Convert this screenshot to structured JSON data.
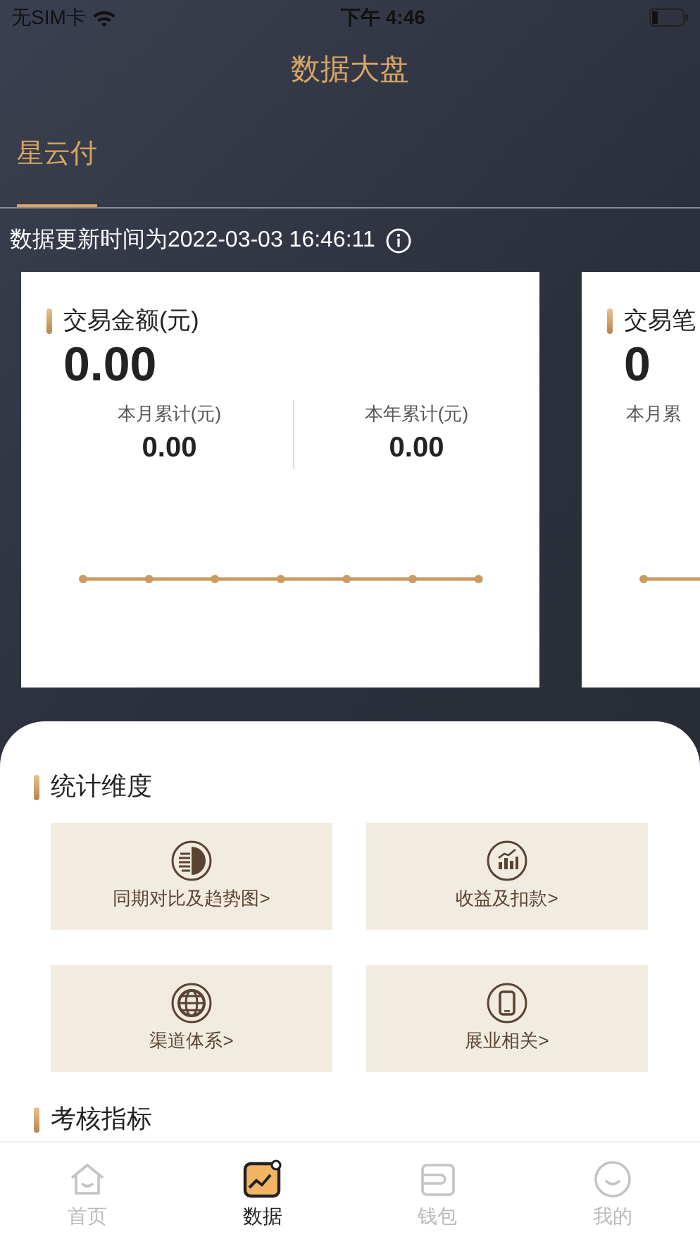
{
  "status_bar": {
    "carrier": "无SIM卡",
    "time": "下午 4:46"
  },
  "title": "数据大盘",
  "tabs": [
    {
      "label": "星云付",
      "selected": true
    }
  ],
  "update_time": "数据更新时间为2022-03-03 16:46:11",
  "cards": [
    {
      "title": "交易金额(元)",
      "value": "0.00",
      "stats": [
        {
          "label": "本月累计(元)",
          "value": "0.00"
        },
        {
          "label": "本年累计(元)",
          "value": "0.00"
        }
      ]
    },
    {
      "title": "交易笔",
      "value": "0",
      "stats": [
        {
          "label": "本月累"
        }
      ]
    }
  ],
  "sections": [
    {
      "title": "统计维度",
      "tiles": [
        {
          "label": "同期对比及趋势图>",
          "kind": "compare"
        },
        {
          "label": "收益及扣款>",
          "kind": "chart"
        },
        {
          "label": "渠道体系>",
          "kind": "globe"
        },
        {
          "label": "展业相关>",
          "kind": "phone"
        }
      ]
    },
    {
      "title": "考核指标"
    }
  ],
  "tab_bar": [
    {
      "label": "首页",
      "kind": "home",
      "selected": false
    },
    {
      "label": "数据",
      "kind": "data",
      "selected": true
    },
    {
      "label": "钱包",
      "kind": "wallet",
      "selected": false
    },
    {
      "label": "我的",
      "kind": "me",
      "selected": false
    }
  ]
}
